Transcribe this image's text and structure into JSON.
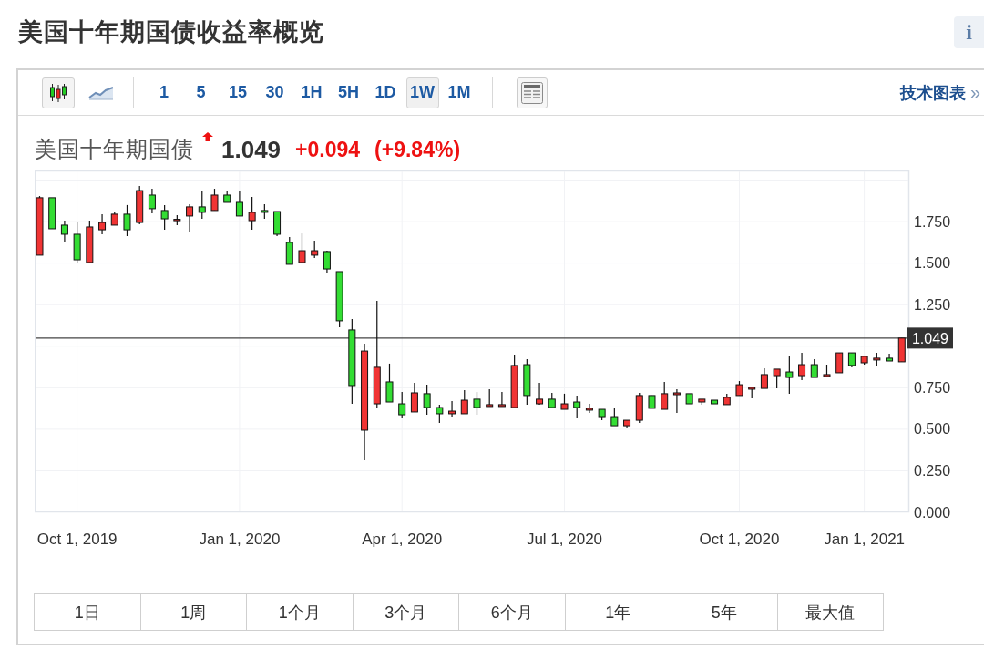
{
  "title": "美国十年期国债收益率概览",
  "info_button": {
    "label": "i"
  },
  "toolbar": {
    "chart_types": [
      {
        "kind": "candlestick",
        "selected": true
      },
      {
        "kind": "line",
        "selected": false
      }
    ],
    "intervals": [
      {
        "label": "1",
        "selected": false
      },
      {
        "label": "5",
        "selected": false
      },
      {
        "label": "15",
        "selected": false
      },
      {
        "label": "30",
        "selected": false
      },
      {
        "label": "1H",
        "selected": false
      },
      {
        "label": "5H",
        "selected": false
      },
      {
        "label": "1D",
        "selected": false
      },
      {
        "label": "1W",
        "selected": true
      },
      {
        "label": "1M",
        "selected": false
      }
    ],
    "link": {
      "label": "技术图表",
      "arrow": "»"
    }
  },
  "quote": {
    "name": "美国十年期国债",
    "rising": true,
    "price": "1.049",
    "change": "+0.094",
    "change_percent": "(+9.84%)"
  },
  "chart": {
    "chart_data": {
      "type": "candlestick",
      "categories": [
        null,
        null,
        null,
        "Oct 1, 2019",
        null,
        null,
        null,
        null,
        null,
        null,
        null,
        null,
        null,
        null,
        null,
        null,
        "Jan 1, 2020",
        null,
        null,
        null,
        null,
        null,
        null,
        null,
        null,
        null,
        null,
        null,
        null,
        "Apr 1, 2020",
        null,
        null,
        null,
        null,
        null,
        null,
        null,
        null,
        null,
        null,
        null,
        null,
        "Jul 1, 2020",
        null,
        null,
        null,
        null,
        null,
        null,
        null,
        null,
        null,
        null,
        null,
        null,
        null,
        "Oct 1, 2020",
        null,
        null,
        null,
        null,
        null,
        null,
        null,
        null,
        null,
        "Jan 1, 2021",
        null,
        null,
        null
      ],
      "ohlc": [
        [
          1.548,
          1.904,
          1.548,
          1.894
        ],
        [
          1.894,
          1.894,
          1.707,
          1.707
        ],
        [
          1.729,
          1.756,
          1.63,
          1.674
        ],
        [
          1.674,
          1.751,
          1.504,
          1.52
        ],
        [
          1.504,
          1.756,
          1.504,
          1.718
        ],
        [
          1.701,
          1.795,
          1.674,
          1.745
        ],
        [
          1.729,
          1.806,
          1.729,
          1.795
        ],
        [
          1.795,
          1.85,
          1.663,
          1.701
        ],
        [
          1.745,
          1.965,
          1.734,
          1.937
        ],
        [
          1.91,
          1.948,
          1.8,
          1.828
        ],
        [
          1.817,
          1.85,
          1.701,
          1.767
        ],
        [
          1.756,
          1.789,
          1.729,
          1.764
        ],
        [
          1.784,
          1.855,
          1.69,
          1.839
        ],
        [
          1.839,
          1.937,
          1.767,
          1.806
        ],
        [
          1.817,
          1.948,
          1.817,
          1.91
        ],
        [
          1.91,
          1.937,
          1.866,
          1.866
        ],
        [
          1.866,
          1.937,
          1.784,
          1.784
        ],
        [
          1.756,
          1.899,
          1.701,
          1.806
        ],
        [
          1.817,
          1.855,
          1.767,
          1.806
        ],
        [
          1.811,
          1.811,
          1.663,
          1.674
        ],
        [
          1.625,
          1.658,
          1.493,
          1.493
        ],
        [
          1.504,
          1.679,
          1.504,
          1.575
        ],
        [
          1.548,
          1.636,
          1.531,
          1.575
        ],
        [
          1.57,
          1.575,
          1.438,
          1.465
        ],
        [
          1.449,
          1.449,
          1.114,
          1.153
        ],
        [
          1.098,
          1.164,
          0.653,
          0.763
        ],
        [
          0.494,
          1.015,
          0.313,
          0.971
        ],
        [
          0.653,
          1.273,
          0.631,
          0.873
        ],
        [
          0.785,
          0.895,
          0.664,
          0.664
        ],
        [
          0.653,
          0.724,
          0.565,
          0.587
        ],
        [
          0.604,
          0.779,
          0.604,
          0.719
        ],
        [
          0.714,
          0.768,
          0.587,
          0.631
        ],
        [
          0.631,
          0.648,
          0.538,
          0.593
        ],
        [
          0.593,
          0.67,
          0.576,
          0.609
        ],
        [
          0.593,
          0.735,
          0.593,
          0.675
        ],
        [
          0.681,
          0.724,
          0.587,
          0.631
        ],
        [
          0.637,
          0.741,
          0.637,
          0.648
        ],
        [
          0.637,
          0.724,
          0.637,
          0.648
        ],
        [
          0.631,
          0.95,
          0.631,
          0.884
        ],
        [
          0.889,
          0.922,
          0.648,
          0.703
        ],
        [
          0.653,
          0.779,
          0.648,
          0.681
        ],
        [
          0.681,
          0.719,
          0.631,
          0.631
        ],
        [
          0.62,
          0.714,
          0.62,
          0.653
        ],
        [
          0.664,
          0.703,
          0.565,
          0.631
        ],
        [
          0.615,
          0.653,
          0.598,
          0.626
        ],
        [
          0.62,
          0.62,
          0.554,
          0.576
        ],
        [
          0.576,
          0.631,
          0.521,
          0.521
        ],
        [
          0.521,
          0.554,
          0.505,
          0.554
        ],
        [
          0.554,
          0.719,
          0.538,
          0.703
        ],
        [
          0.703,
          0.703,
          0.626,
          0.626
        ],
        [
          0.62,
          0.785,
          0.62,
          0.714
        ],
        [
          0.708,
          0.741,
          0.598,
          0.719
        ],
        [
          0.714,
          0.714,
          0.653,
          0.653
        ],
        [
          0.664,
          0.681,
          0.648,
          0.681
        ],
        [
          0.675,
          0.675,
          0.653,
          0.653
        ],
        [
          0.648,
          0.714,
          0.648,
          0.692
        ],
        [
          0.703,
          0.79,
          0.703,
          0.768
        ],
        [
          0.741,
          0.757,
          0.686,
          0.752
        ],
        [
          0.746,
          0.867,
          0.746,
          0.829
        ],
        [
          0.823,
          0.862,
          0.746,
          0.862
        ],
        [
          0.845,
          0.939,
          0.714,
          0.812
        ],
        [
          0.823,
          0.96,
          0.796,
          0.889
        ],
        [
          0.889,
          0.922,
          0.812,
          0.812
        ],
        [
          0.818,
          0.889,
          0.818,
          0.829
        ],
        [
          0.84,
          0.96,
          0.84,
          0.96
        ],
        [
          0.96,
          0.96,
          0.873,
          0.884
        ],
        [
          0.9,
          0.939,
          0.889,
          0.939
        ],
        [
          0.917,
          0.96,
          0.884,
          0.928
        ],
        [
          0.928,
          0.955,
          0.911,
          0.911
        ],
        [
          0.906,
          1.049,
          0.906,
          1.049
        ]
      ],
      "ylim": [
        0,
        2.058
      ],
      "yticks": [
        {
          "value": 1.75,
          "label": "1.750"
        },
        {
          "value": 1.5,
          "label": "1.500"
        },
        {
          "value": 1.25,
          "label": "1.250"
        },
        {
          "value": 0.75,
          "label": "0.750"
        },
        {
          "value": 0.5,
          "label": "0.500"
        },
        {
          "value": 0.25,
          "label": "0.250"
        },
        {
          "value": 0,
          "label": "0.000"
        }
      ],
      "grid": true,
      "ref_lines": [
        {
          "axis": "y",
          "value": 1.049,
          "label": "1.049"
        }
      ]
    }
  },
  "ranges": [
    {
      "label": "1日",
      "selected": false
    },
    {
      "label": "1周",
      "selected": false
    },
    {
      "label": "1个月",
      "selected": false
    },
    {
      "label": "3个月",
      "selected": false
    },
    {
      "label": "6个月",
      "selected": false
    },
    {
      "label": "1年",
      "selected": false
    },
    {
      "label": "5年",
      "selected": false
    },
    {
      "label": "最大值",
      "selected": false
    }
  ]
}
